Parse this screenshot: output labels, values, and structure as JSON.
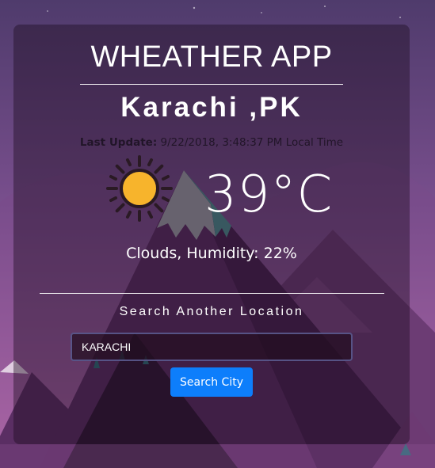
{
  "app": {
    "title": "WHEATHER APP"
  },
  "weather": {
    "city": "Karachi ,PK",
    "last_update_label": "Last Update:",
    "last_update_value": "9/22/2018, 3:48:37 PM Local Time",
    "icon": "sun-icon",
    "temperature": "39°C",
    "conditions": "Clouds, Humidity: 22%"
  },
  "search": {
    "heading": "Search Another Location",
    "input_value": "KARACHI",
    "button_label": "Search City"
  },
  "colors": {
    "button": "#0d7efb",
    "sun": "#f7b42c"
  }
}
